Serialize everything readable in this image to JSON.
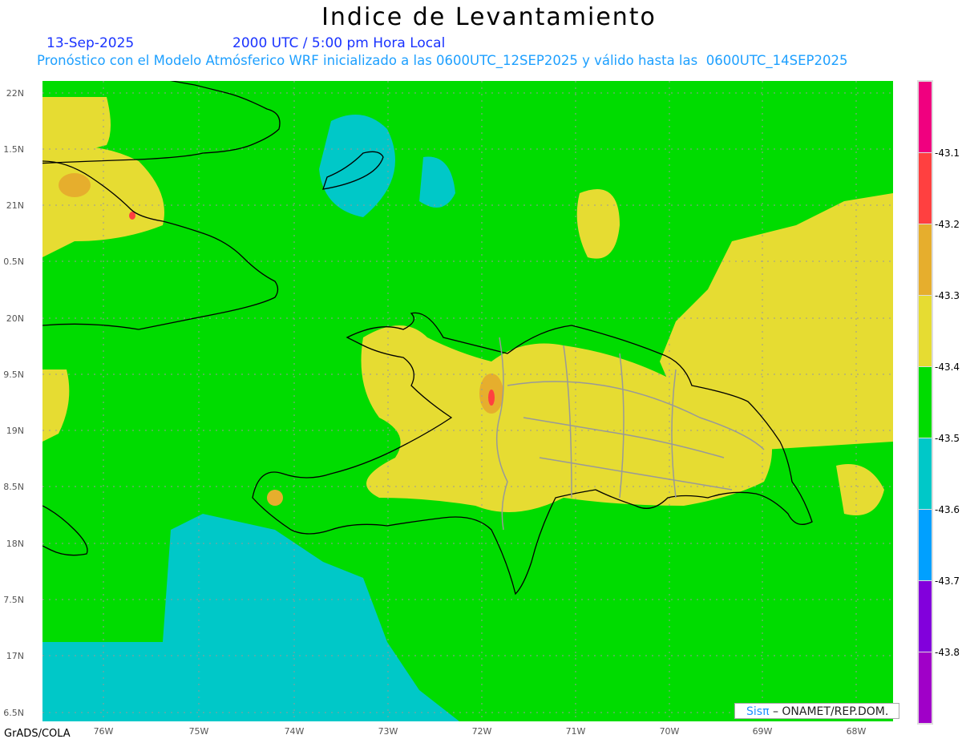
{
  "title": "Indice de Levantamiento",
  "date": "13-Sep-2025",
  "time": "2000 UTC / 5:00 pm Hora Local",
  "description": "Pronóstico con el Modelo Atmósferico WRF inicializado a las 0600UTC_12SEP2025 y válido hasta las  0600UTC_14SEP2025",
  "lat_labels": [
    "22N",
    "1.5N",
    "21N",
    "0.5N",
    "20N",
    "9.5N",
    "19N",
    "8.5N",
    "18N",
    "7.5N",
    "17N",
    "6.5N"
  ],
  "lon_labels": [
    "76W",
    "75W",
    "74W",
    "73W",
    "72W",
    "71W",
    "70W",
    "69W",
    "68W"
  ],
  "colorbar": {
    "labels": [
      "-43.1",
      "-43.2",
      "-43.3",
      "-43.4",
      "-43.5",
      "-43.6",
      "-43.7",
      "-43.8"
    ],
    "colors": [
      "#f0007f",
      "#ff4040",
      "#e6ae2d",
      "#e6dc32",
      "#00dc00",
      "#00c8c8",
      "#00a0ff",
      "#8200dc",
      "#a000c8"
    ]
  },
  "footer": {
    "software": "GrADS/COLA",
    "logo_sis": "Sisπ",
    "logo_text": "– ONAMET/REP.DOM."
  }
}
